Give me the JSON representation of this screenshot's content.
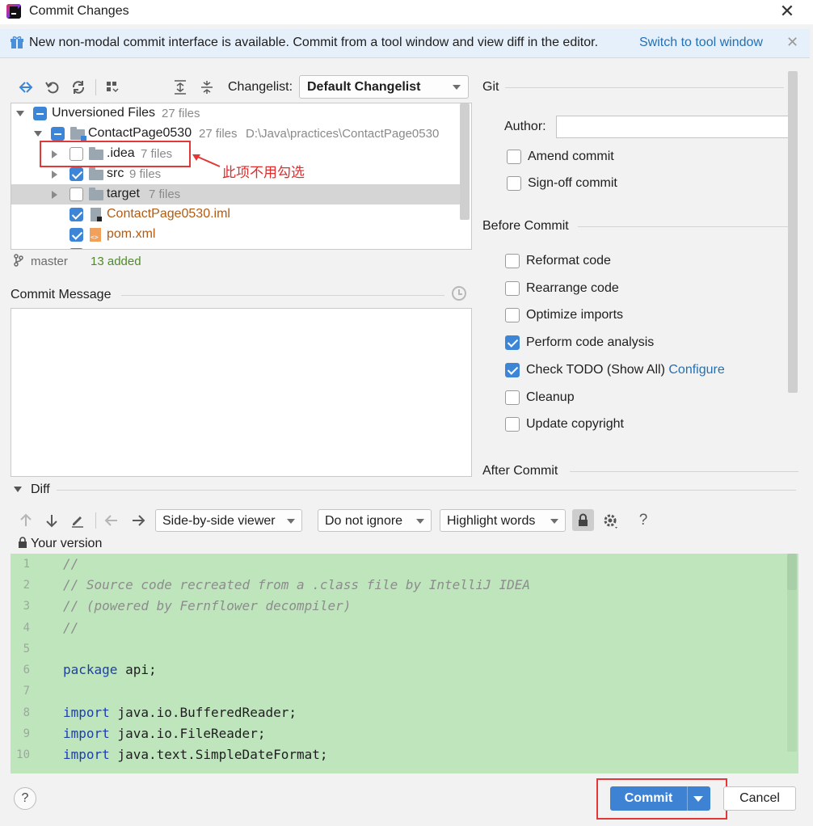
{
  "window": {
    "title": "Commit Changes",
    "close_glyph": "✕"
  },
  "banner": {
    "text": "New non-modal commit interface is available. Commit from a tool window and view diff in the editor.",
    "link": "Switch to tool window",
    "close_glyph": "✕"
  },
  "toolbar": {
    "changelist_label": "Changelist:",
    "changelist_value": "Default Changelist"
  },
  "tree": {
    "rows": [
      {
        "name": "Unversioned Files",
        "count": "27 files",
        "path": "",
        "checkbox": "partial",
        "expanded": true
      },
      {
        "name": "ContactPage0530",
        "count": "27 files",
        "path": "D:\\Java\\practices\\ContactPage0530",
        "checkbox": "partial",
        "expanded": true
      },
      {
        "name": ".idea",
        "count": "7 files",
        "path": "",
        "checkbox": "off",
        "expanded": false
      },
      {
        "name": "src",
        "count": "9 files",
        "path": "",
        "checkbox": "on",
        "expanded": false
      },
      {
        "name": "target",
        "count": "7 files",
        "path": "",
        "checkbox": "off",
        "expanded": false
      },
      {
        "name": "ContactPage0530.iml",
        "count": "",
        "path": "",
        "checkbox": "on",
        "expanded": false
      },
      {
        "name": "pom.xml",
        "count": "",
        "path": "",
        "checkbox": "on",
        "expanded": false
      }
    ]
  },
  "annotation": {
    "text": "此项不用勾选",
    "color": "#e02c2c"
  },
  "branch": {
    "name": "master",
    "status": "13 added"
  },
  "commit_message": {
    "label": "Commit Message",
    "value": ""
  },
  "git": {
    "title": "Git",
    "author_label": "Author:",
    "author_value": "",
    "amend_label": "Amend commit",
    "signoff_label": "Sign-off commit"
  },
  "before_commit": {
    "title": "Before Commit",
    "options": [
      {
        "label": "Reformat code",
        "checked": false
      },
      {
        "label": "Rearrange code",
        "checked": false
      },
      {
        "label": "Optimize imports",
        "checked": false
      },
      {
        "label": "Perform code analysis",
        "checked": true
      },
      {
        "label": "Check TODO (Show All)",
        "checked": true,
        "link": "Configure"
      },
      {
        "label": "Cleanup",
        "checked": false
      },
      {
        "label": "Update copyright",
        "checked": false
      }
    ]
  },
  "after_commit": {
    "title": "After Commit"
  },
  "diff": {
    "label": "Diff",
    "viewer": "Side-by-side viewer",
    "ignore": "Do not ignore",
    "highlight": "Highlight words",
    "help_glyph": "?",
    "your_version": "Your version",
    "lines": [
      {
        "n": "1",
        "text": "//",
        "kind": "comment"
      },
      {
        "n": "2",
        "text": "// Source code recreated from a .class file by IntelliJ IDEA",
        "kind": "comment"
      },
      {
        "n": "3",
        "text": "// (powered by Fernflower decompiler)",
        "kind": "comment"
      },
      {
        "n": "4",
        "text": "//",
        "kind": "comment"
      },
      {
        "n": "5",
        "text": "",
        "kind": "plain"
      },
      {
        "n": "6",
        "kw": "package",
        "rest": " api;",
        "kind": "kw"
      },
      {
        "n": "7",
        "text": "",
        "kind": "plain"
      },
      {
        "n": "8",
        "kw": "import",
        "rest": " java.io.BufferedReader;",
        "kind": "kw"
      },
      {
        "n": "9",
        "kw": "import",
        "rest": " java.io.FileReader;",
        "kind": "kw"
      },
      {
        "n": "10",
        "kw": "import",
        "rest": " java.text.SimpleDateFormat;",
        "kind": "kw"
      }
    ]
  },
  "footer": {
    "help_glyph": "?",
    "commit_label": "Commit",
    "cancel_label": "Cancel"
  },
  "colors": {
    "accent": "#3e82d4",
    "link": "#2470b3",
    "diff_bg": "#bfe5bd",
    "annotation": "#e13838"
  }
}
